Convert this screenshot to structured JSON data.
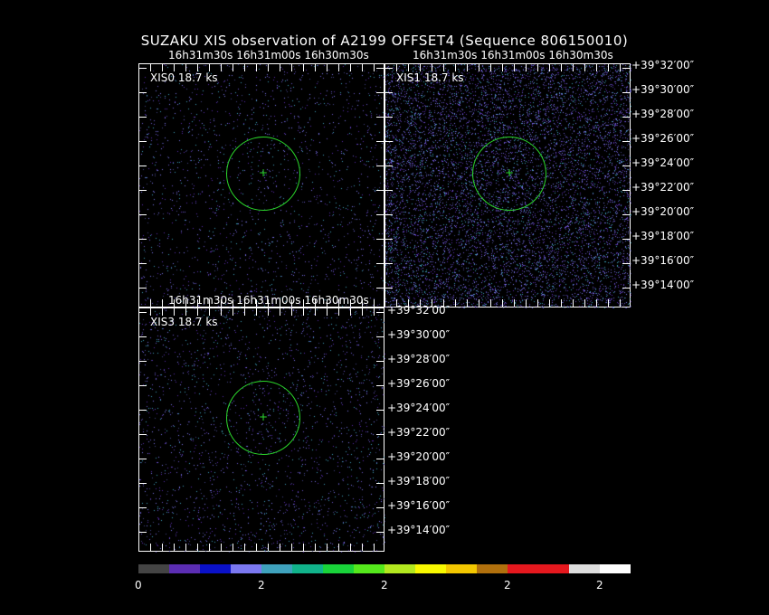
{
  "title": "SUZAKU XIS observation of A2199 OFFSET4  (Sequence 806150010)",
  "panels": [
    {
      "label": "XIS0 18.7 ks"
    },
    {
      "label": "XIS1 18.7 ks"
    },
    {
      "label": "XIS3 18.7 ks"
    }
  ],
  "ra_labels": [
    "16h31m30s",
    "16h31m00s",
    "16h30m30s"
  ],
  "dec_labels": [
    "+39°32′00″",
    "+39°30′00″",
    "+39°28′00″",
    "+39°26′00″",
    "+39°24′00″",
    "+39°22′00″",
    "+39°20′00″",
    "+39°18′00″",
    "+39°16′00″",
    "+39°14′00″"
  ],
  "colorbar": {
    "colors": [
      "#444444",
      "#5b2db3",
      "#0a11c8",
      "#7b78f0",
      "#3fa2bd",
      "#11b38b",
      "#19d33a",
      "#55e81c",
      "#b3e81f",
      "#f8f800",
      "#f3c700",
      "#b1700d",
      "#e5181e",
      "#e5181e",
      "#dddddd",
      "#ffffff"
    ],
    "labels": [
      "0",
      "2",
      "2",
      "2",
      "2"
    ]
  },
  "colors": {
    "background": "#000000",
    "region": "#2bd62b"
  }
}
